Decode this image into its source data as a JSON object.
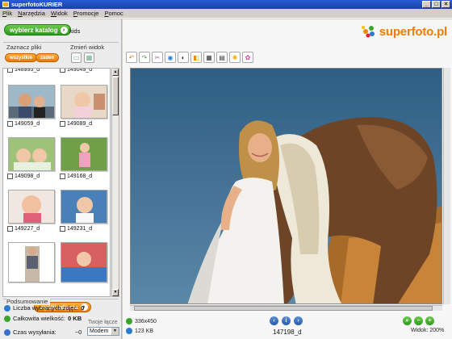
{
  "window": {
    "title": "superfotoKURIER"
  },
  "menu": [
    {
      "id": "file",
      "label": "Plik"
    },
    {
      "id": "tools",
      "label": "Narzędzia"
    },
    {
      "id": "view",
      "label": "Widok"
    },
    {
      "id": "promo",
      "label": "Promocje"
    },
    {
      "id": "help",
      "label": "Pomoc"
    }
  ],
  "left": {
    "choose_catalog_label": "wybierz katalog",
    "catalog_name": "kids",
    "select_files_label": "Zaznacz pliki",
    "change_view_label": "Zmień widok",
    "select_all_label": "wszystkie",
    "select_none_label": "żaden",
    "thumbnails": [
      {
        "name": "148995_d"
      },
      {
        "name": "149049_d"
      },
      {
        "name": "149059_d"
      },
      {
        "name": "149089_d"
      },
      {
        "name": "149098_d"
      },
      {
        "name": "149168_d"
      },
      {
        "name": "149227_d"
      },
      {
        "name": "149231_d"
      },
      {
        "name": ""
      },
      {
        "name": ""
      }
    ],
    "send_button_label": "wyślij zdjęcia",
    "summary_title": "Podsumowanie",
    "selected_count_label": "Liczba wybranych zdjęć:",
    "selected_count_value": "0",
    "total_size_label": "Całkowita wielkość:",
    "total_size_value": "0 KB",
    "send_time_label": "Czas wysyłania:",
    "send_time_value": "~0",
    "connection_label": "Twoje łącze",
    "connection_value": "Modem"
  },
  "right": {
    "logo_text": "superfoto.pl",
    "tools": [
      {
        "icon": "rotate-left-icon",
        "glyph": "↶"
      },
      {
        "icon": "rotate-right-icon",
        "glyph": "↷"
      },
      {
        "icon": "crop-icon",
        "glyph": "✂"
      },
      {
        "icon": "red-eye-icon",
        "glyph": "◉"
      },
      {
        "icon": "contrast-icon",
        "glyph": "◐"
      },
      {
        "icon": "sepia-icon",
        "glyph": "◧"
      },
      {
        "icon": "film-strip-icon",
        "glyph": "▦"
      },
      {
        "icon": "film-strip-2-icon",
        "glyph": "▤"
      },
      {
        "icon": "brightness-icon",
        "glyph": "✺"
      },
      {
        "icon": "color-balance-icon",
        "glyph": "✿"
      }
    ],
    "dimensions": "336x450",
    "filesize": "123 KB",
    "filename": "147198_d",
    "zoom_label": "Widok: 200%"
  },
  "colors": {
    "accent_green": "#3aa52a",
    "accent_orange": "#f08800",
    "titlebar_blue": "#2a5bd7"
  }
}
